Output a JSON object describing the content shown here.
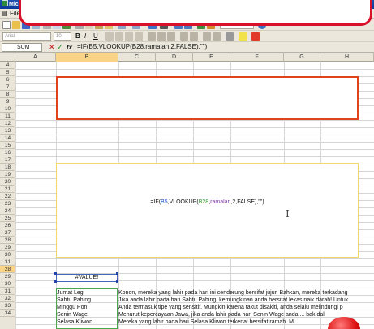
{
  "window": {
    "app_title": "Microsoft Excel"
  },
  "menu": {
    "items": [
      "File"
    ]
  },
  "toolbar2": {
    "font_name": "Arial",
    "font_size": "10",
    "zoom": "100%"
  },
  "formula_bar": {
    "name_box": "SUM",
    "fx": "fx",
    "formula": "=IF(B5,VLOOKUP(B28,ramalan,2,FALSE),\"\")"
  },
  "columns": [
    "A",
    "B",
    "C",
    "D",
    "E",
    "F",
    "G",
    "H"
  ],
  "rows": [
    "4",
    "5",
    "6",
    "7",
    "8",
    "9",
    "10",
    "11",
    "12",
    "13",
    "14",
    "15",
    "16",
    "17",
    "18",
    "19",
    "20",
    "21",
    "22",
    "23",
    "24",
    "25",
    "26",
    "27",
    "28",
    "29",
    "30",
    "31",
    "32",
    "33",
    "34"
  ],
  "shape_formula": {
    "prefix": "=IF(",
    "ref1": "B5",
    "mid1": ",VLOOKUP(",
    "ref2": "B28",
    "mid2": ",",
    "ref3": "ramalan",
    "suffix": ",2,FALSE),\"\")"
  },
  "selected_cell_value": "#VALUE!",
  "data_rows": [
    {
      "day": "Jumat Legi",
      "text": "Konon, mereka yang lahir pada hari ini cenderung bersifat jujur. Bahkan, mereka terkadang"
    },
    {
      "day": "Sabtu Pahing",
      "text": "Jika anda lahir pada hari Sabtu Pahing, kemungkinan anda bersifat lekas naik darah! Untuk"
    },
    {
      "day": "Minggu Pon",
      "text": "Anda termasuk tipe yang sensitif. Mungkin karena takut disakiti, anda selalu melindungi p"
    },
    {
      "day": "Senin Wage",
      "text": "Menurut kepercayaan Jawa, jika anda lahir pada hari Senin Wage anda ... bak dal"
    },
    {
      "day": "Selasa Kliwon",
      "text": "Mereka yang lahir pada hari Selasa Kliwon terkenal bersifat ramah. M..."
    }
  ]
}
